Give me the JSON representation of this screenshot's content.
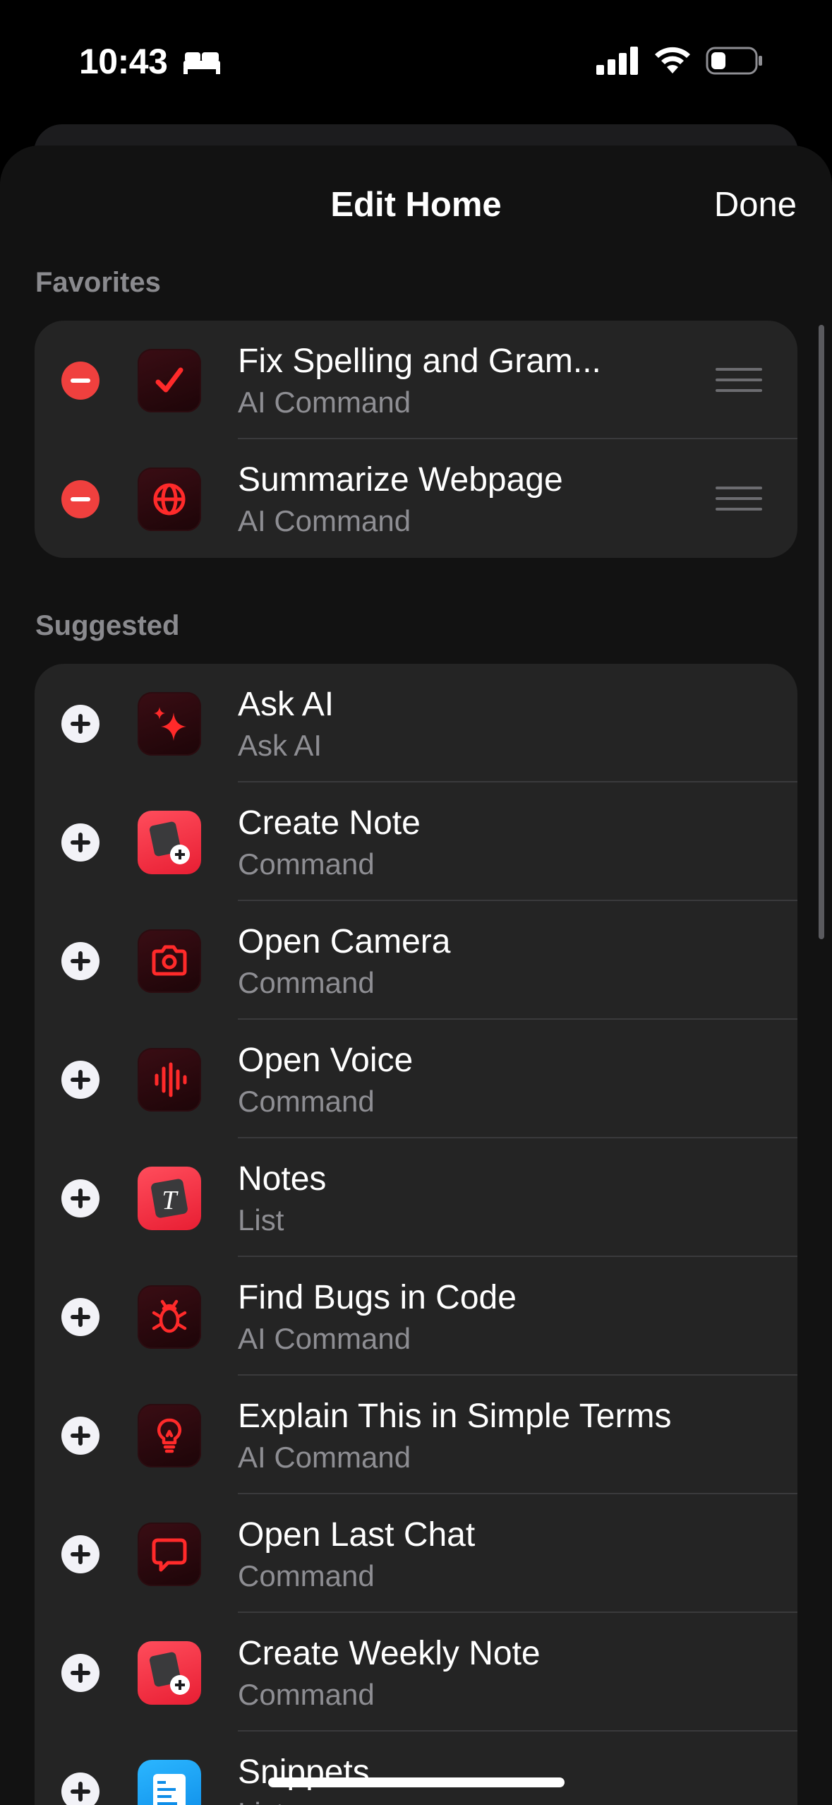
{
  "status_bar": {
    "time": "10:43",
    "icons": [
      "bed-icon",
      "cellular-signal-icon",
      "wifi-icon",
      "battery-icon"
    ]
  },
  "header": {
    "title": "Edit Home",
    "done_label": "Done"
  },
  "favorites": {
    "header": "Favorites",
    "items": [
      {
        "title": "Fix Spelling and Gram...",
        "subtitle": "AI Command",
        "icon": "checkmark-icon"
      },
      {
        "title": "Summarize Webpage",
        "subtitle": "AI Command",
        "icon": "globe-icon"
      }
    ]
  },
  "suggested": {
    "header": "Suggested",
    "items": [
      {
        "title": "Ask AI",
        "subtitle": "Ask AI",
        "icon": "sparkles-icon"
      },
      {
        "title": "Create Note",
        "subtitle": "Command",
        "icon": "note-plus-icon"
      },
      {
        "title": "Open Camera",
        "subtitle": "Command",
        "icon": "camera-icon"
      },
      {
        "title": "Open Voice",
        "subtitle": "Command",
        "icon": "waveform-icon"
      },
      {
        "title": "Notes",
        "subtitle": "List",
        "icon": "text-note-icon"
      },
      {
        "title": "Find Bugs in Code",
        "subtitle": "AI Command",
        "icon": "bug-icon"
      },
      {
        "title": "Explain This in Simple Terms",
        "subtitle": "AI Command",
        "icon": "lightbulb-icon"
      },
      {
        "title": "Open Last Chat",
        "subtitle": "Command",
        "icon": "chat-bubble-icon"
      },
      {
        "title": "Create Weekly Note",
        "subtitle": "Command",
        "icon": "note-plus-icon"
      },
      {
        "title": "Snippets",
        "subtitle": "List",
        "icon": "snippets-icon"
      }
    ]
  },
  "colors": {
    "accent_red": "#f0403e",
    "icon_red": "#ff2a2a",
    "background": "#121212",
    "card": "#242424",
    "secondary_text": "#8e8e93"
  }
}
